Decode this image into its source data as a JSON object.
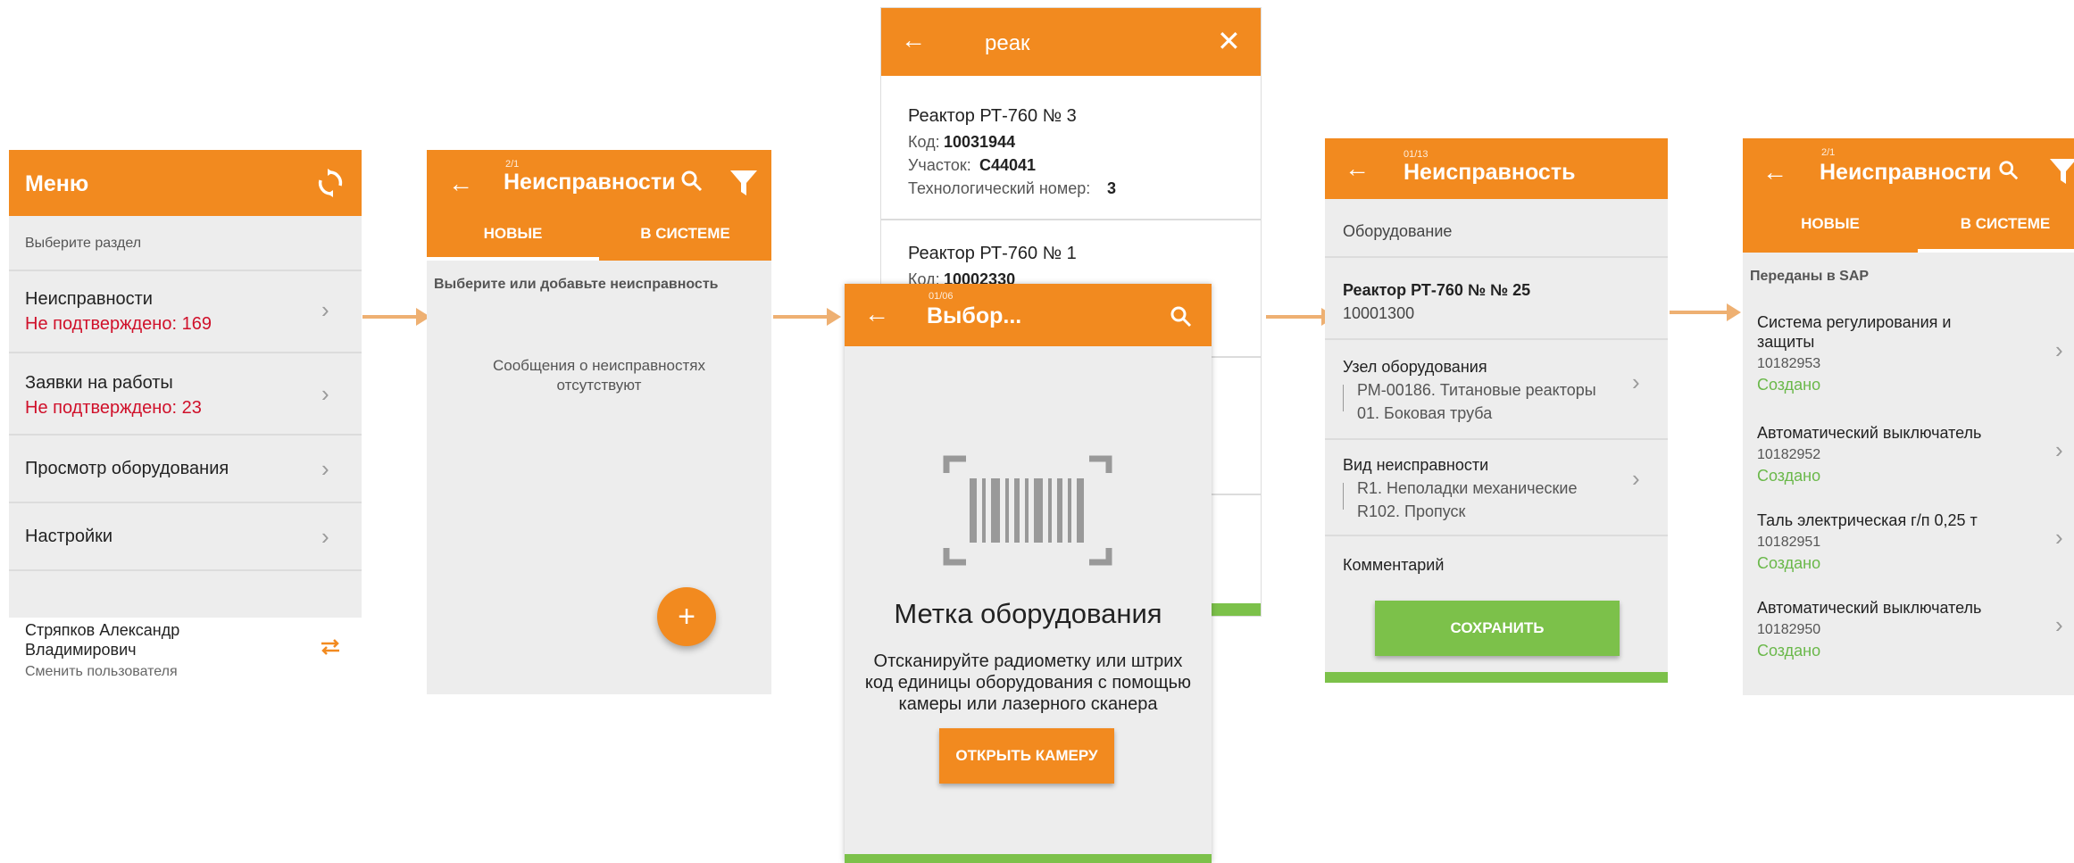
{
  "screen1": {
    "title": "Меню",
    "section_hint": "Выберите раздел",
    "items": [
      {
        "label": "Неисправности",
        "sub": "Не подтверждено: 169"
      },
      {
        "label": "Заявки на работы",
        "sub": "Не подтверждено: 23"
      },
      {
        "label": "Просмотр оборудования"
      },
      {
        "label": "Настройки"
      }
    ],
    "user_name_1": "Стряпков Александр",
    "user_name_2": "Владимирович",
    "switch_user": "Сменить пользователя",
    "icons": {
      "sync": "sync-icon",
      "chevron": "chevron-right-icon",
      "swap": "swap-icon"
    }
  },
  "screen2": {
    "counter": "2/1",
    "title": "Неисправности",
    "tabs": [
      "НОВЫЕ",
      "В СИСТЕМЕ"
    ],
    "hint": "Выберите или добавьте неисправность",
    "empty_1": "Сообщения о неисправностях",
    "empty_2": "отсутствуют",
    "fab": "+"
  },
  "screen3": {
    "search_value": "реак",
    "results": [
      {
        "name": "Реактор РТ-760 № 3",
        "code_label": "Код:",
        "code": "10031944",
        "area_label": "Участок:",
        "area": "C44041",
        "tech_label": "Технологический номер:",
        "tech": "3"
      },
      {
        "name": "Реактор РТ-760 № 1",
        "code_label": "Код:",
        "code": "10002330"
      }
    ]
  },
  "screen4": {
    "counter": "01/06",
    "title": "Выбор...",
    "heading": "Метка оборудования",
    "desc_1": "Отсканируйте радиометку или штрих",
    "desc_2": "код единицы оборудования с помощью",
    "desc_3": "камеры или лазерного сканера",
    "button": "ОТКРЫТЬ КАМЕРУ"
  },
  "screen5": {
    "counter": "01/13",
    "title": "Неисправность",
    "section": "Оборудование",
    "equip_name": "Реактор РТ-760 № № 25",
    "equip_code": "10001300",
    "node_label": "Узел оборудования",
    "node_1": "РМ-00186. Титановые реакторы",
    "node_2": "01. Боковая труба",
    "fault_label": "Вид неисправности",
    "fault_1": "R1. Неполадки механические",
    "fault_2": "R102. Пропуск",
    "comment_label": "Комментарий",
    "save": "СОХРАНИТЬ"
  },
  "screen6": {
    "counter": "2/1",
    "title": "Неисправности",
    "tabs": [
      "НОВЫЕ",
      "В СИСТЕМЕ"
    ],
    "section": "Переданы в SAP",
    "items": [
      {
        "title_1": "Система регулирования и",
        "title_2": "защиты",
        "code": "10182953",
        "status": "Создано"
      },
      {
        "title_1": "Автоматический выключатель",
        "code": "10182952",
        "status": "Создано"
      },
      {
        "title_1": "Таль электрическая г/п 0,25 т",
        "code": "10182951",
        "status": "Создано"
      },
      {
        "title_1": "Автоматический выключатель",
        "code": "10182950",
        "status": "Создано"
      }
    ]
  },
  "colors": {
    "accent": "#f28a1f",
    "green": "#7cc14a",
    "alert": "#d0102a",
    "arrow": "#eeb072"
  }
}
